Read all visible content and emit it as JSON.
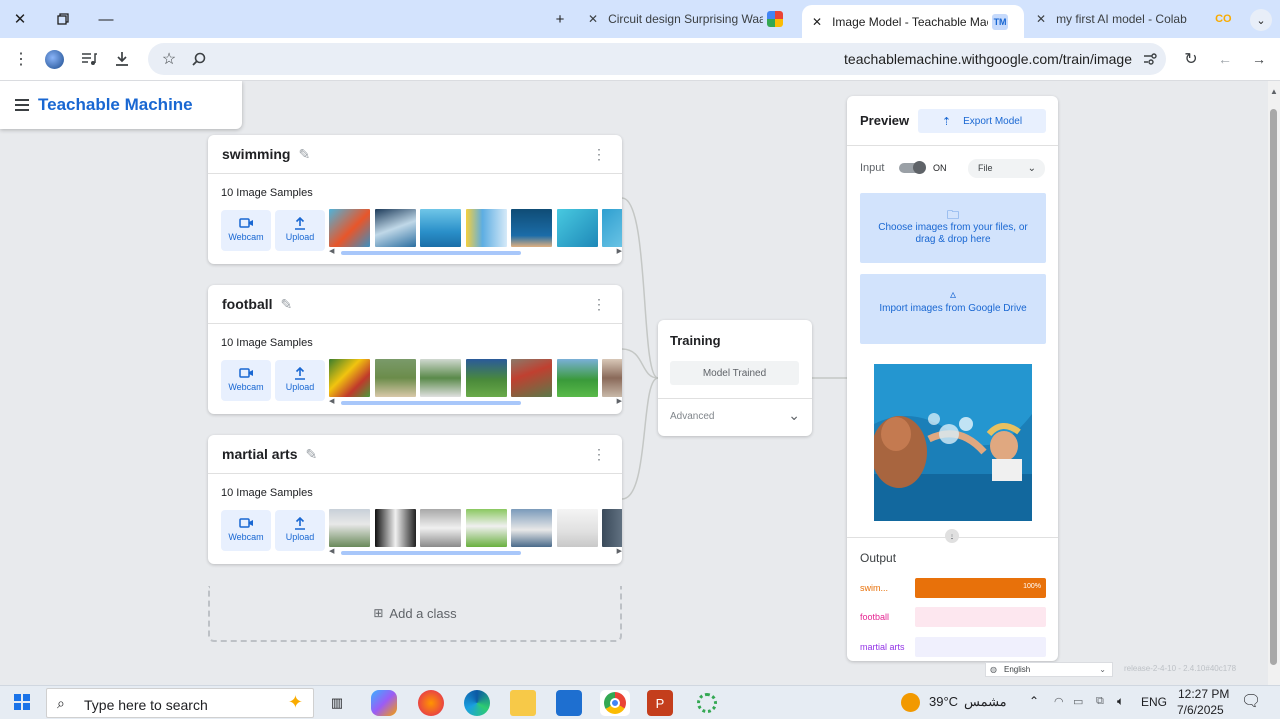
{
  "browser": {
    "tabs": [
      {
        "title": "Circuit design Surprising Waasa",
        "active": false
      },
      {
        "title": "Image Model - Teachable Mach",
        "active": true
      },
      {
        "title": "my first AI model - Colab",
        "active": false
      }
    ],
    "url": "teachablemachine.withgoogle.com/train/image"
  },
  "app": {
    "title": "Teachable Machine"
  },
  "classes": [
    {
      "name": "swimming",
      "samples": "10 Image Samples",
      "webcam": "Webcam",
      "upload": "Upload"
    },
    {
      "name": "football",
      "samples": "10 Image Samples",
      "webcam": "Webcam",
      "upload": "Upload"
    },
    {
      "name": "martial arts",
      "samples": "10 Image Samples",
      "webcam": "Webcam",
      "upload": "Upload"
    }
  ],
  "add_class": "Add a class",
  "training": {
    "title": "Training",
    "button": "Model Trained",
    "advanced": "Advanced"
  },
  "preview": {
    "title": "Preview",
    "export": "Export Model",
    "input_label": "Input",
    "toggle_state": "ON",
    "source": "File",
    "choose_files": "Choose images from your files, or drag & drop here",
    "google_drive": "Import images from Google Drive",
    "output_title": "Output",
    "outputs": [
      {
        "label": "swim...",
        "value": 1.0,
        "pct_label": "100%",
        "color": "#e8710a",
        "track": "#fce8e6"
      },
      {
        "label": "football",
        "value": 0.0,
        "pct_label": "",
        "color": "#e52592",
        "track": "#fde7ef"
      },
      {
        "label": "martial arts",
        "value": 0.0,
        "pct_label": "",
        "color": "#9334e6",
        "track": "#f0f0fd"
      }
    ]
  },
  "footer": {
    "language": "English",
    "release": "release-2-4-10 - 2.4.10#40c178"
  },
  "taskbar": {
    "search_placeholder": "Type here to search",
    "weather": "39°C",
    "weather_desc": "مشمس",
    "language": "ENG",
    "time": "12:27 PM",
    "date": "7/6/2025"
  }
}
